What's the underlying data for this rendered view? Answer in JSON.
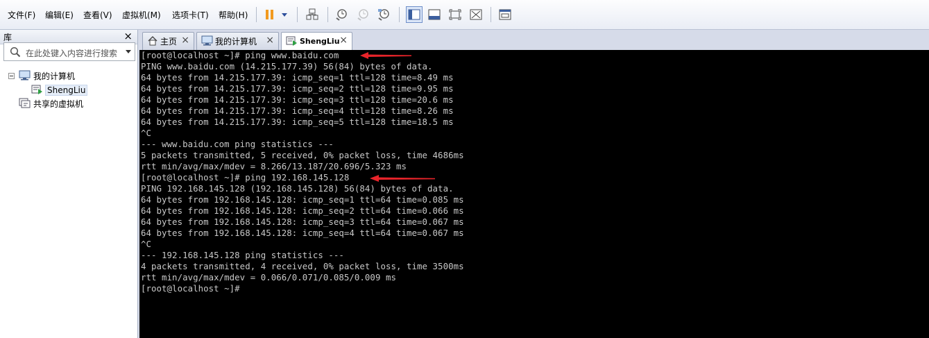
{
  "menubar": {
    "items": [
      "文件(F)",
      "编辑(E)",
      "查看(V)",
      "虚拟机(M)",
      "选项卡(T)",
      "帮助(H)"
    ]
  },
  "toolbar": {
    "icons": [
      "pause-icon",
      "dropdown-icon",
      "send-ctrl-alt-del-icon",
      "snapshot-icon",
      "revert-snapshot-icon",
      "snapshot-manager-icon",
      "console-view-icon",
      "fullscreen-icon",
      "unity-icon",
      "stretch-icon",
      "thumbnail-view-icon"
    ],
    "accent": "#f29a1f"
  },
  "library": {
    "title": "库",
    "close": "×",
    "search_placeholder": "在此处键入内容进行搜索",
    "tree": {
      "root": "我的计算机",
      "child": "ShengLiu",
      "shared": "共享的虚拟机"
    }
  },
  "tabs": [
    {
      "label": "主页",
      "close": "×"
    },
    {
      "label": "我的计算机",
      "close": "×"
    },
    {
      "label": "ShengLiu",
      "close": "×"
    }
  ],
  "terminal": {
    "lines": [
      "[root@localhost ~]# ping www.baidu.com",
      "PING www.baidu.com (14.215.177.39) 56(84) bytes of data.",
      "64 bytes from 14.215.177.39: icmp_seq=1 ttl=128 time=8.49 ms",
      "64 bytes from 14.215.177.39: icmp_seq=2 ttl=128 time=9.95 ms",
      "64 bytes from 14.215.177.39: icmp_seq=3 ttl=128 time=20.6 ms",
      "64 bytes from 14.215.177.39: icmp_seq=4 ttl=128 time=8.26 ms",
      "64 bytes from 14.215.177.39: icmp_seq=5 ttl=128 time=18.5 ms",
      "^C",
      "--- www.baidu.com ping statistics ---",
      "5 packets transmitted, 5 received, 0% packet loss, time 4686ms",
      "rtt min/avg/max/mdev = 8.266/13.187/20.696/5.323 ms",
      "[root@localhost ~]# ping 192.168.145.128",
      "PING 192.168.145.128 (192.168.145.128) 56(84) bytes of data.",
      "64 bytes from 192.168.145.128: icmp_seq=1 ttl=64 time=0.085 ms",
      "64 bytes from 192.168.145.128: icmp_seq=2 ttl=64 time=0.066 ms",
      "64 bytes from 192.168.145.128: icmp_seq=3 ttl=64 time=0.067 ms",
      "64 bytes from 192.168.145.128: icmp_seq=4 ttl=64 time=0.067 ms",
      "^C",
      "--- 192.168.145.128 ping statistics ---",
      "4 packets transmitted, 4 received, 0% packet loss, time 3500ms",
      "rtt min/avg/max/mdev = 0.066/0.071/0.085/0.009 ms",
      "[root@localhost ~]#"
    ],
    "annotation_color": "#e8242a"
  }
}
